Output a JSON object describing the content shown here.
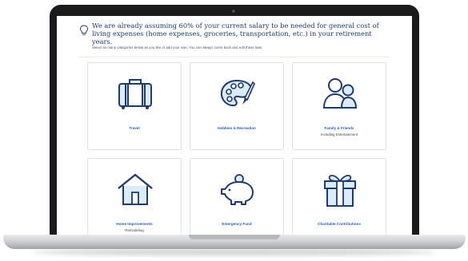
{
  "banner": {
    "headline": "We are already assuming 60% of your current salary to be needed for general cost of living expenses (home expenses, groceries, transportation, etc.) in your retirement years.",
    "subtext": "Select as many categories below as you like or add your own. You can always come back and edit these later."
  },
  "categories": [
    {
      "label": "Travel",
      "sublabel": "",
      "icon": "suitcase-icon"
    },
    {
      "label": "Hobbies & Recreation",
      "sublabel": "",
      "icon": "paint-palette-icon"
    },
    {
      "label": "Family & Friends",
      "sublabel": "Including Entertainment",
      "icon": "people-icon"
    },
    {
      "label": "Home Improvements",
      "sublabel": "Remodeling",
      "icon": "house-icon"
    },
    {
      "label": "Emergency Fund",
      "sublabel": "",
      "icon": "piggy-bank-icon"
    },
    {
      "label": "Charitable Contributions",
      "sublabel": "",
      "icon": "gift-icon"
    }
  ],
  "colors": {
    "icon_stroke": "#1f3b6b",
    "icon_fill": "#dcebfa",
    "label": "#2a5db0",
    "headline": "#1f3b6b"
  }
}
